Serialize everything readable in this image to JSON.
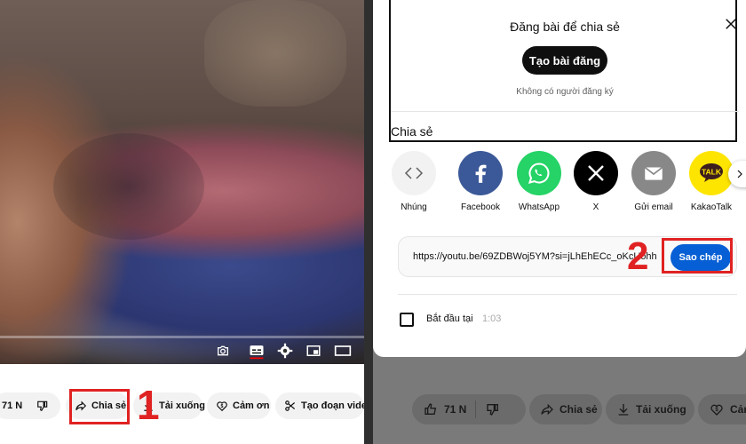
{
  "left_panel": {
    "video_controls": [
      "camera-icon",
      "subtitles-icon",
      "settings-icon",
      "miniplayer-icon",
      "theater-mode-icon"
    ],
    "actions": {
      "like_count": "71 N",
      "share_label": "Chia sẻ",
      "download_label": "Tải xuống",
      "thanks_label": "Cảm ơn",
      "clip_label": "Tạo đoạn video"
    },
    "step_number": "1"
  },
  "share_dialog": {
    "post_title": "Đăng bài để chia sẻ",
    "create_post_button": "Tạo bài đăng",
    "subscriber_note": "Không có người đăng ký",
    "share_section_label": "Chia sẻ",
    "apps": [
      {
        "label": "Nhúng",
        "icon": "embed-icon",
        "color": "#f2f2f2"
      },
      {
        "label": "Facebook",
        "icon": "facebook-icon",
        "color": "#3b5998"
      },
      {
        "label": "WhatsApp",
        "icon": "whatsapp-icon",
        "color": "#25d366"
      },
      {
        "label": "X",
        "icon": "x-icon",
        "color": "#000000"
      },
      {
        "label": "Gửi email",
        "icon": "email-icon",
        "color": "#888888"
      },
      {
        "label": "KakaoTalk",
        "icon": "kakaotalk-icon",
        "color": "#fee500"
      }
    ],
    "share_url": "https://youtu.be/69ZDBWoj5YM?si=jLhEhECc_oKcUohh",
    "copy_button": "Sao chép",
    "start_at_label": "Bắt đầu tại",
    "start_at_time": "1:03",
    "step_number": "2"
  },
  "right_panel": {
    "actions": {
      "like_count": "71 N",
      "share_label": "Chia sẻ",
      "download_label": "Tải xuống",
      "thanks_label": "Cảm"
    }
  },
  "colors": {
    "highlight": "#e02222",
    "copy_button": "#065fd4"
  }
}
